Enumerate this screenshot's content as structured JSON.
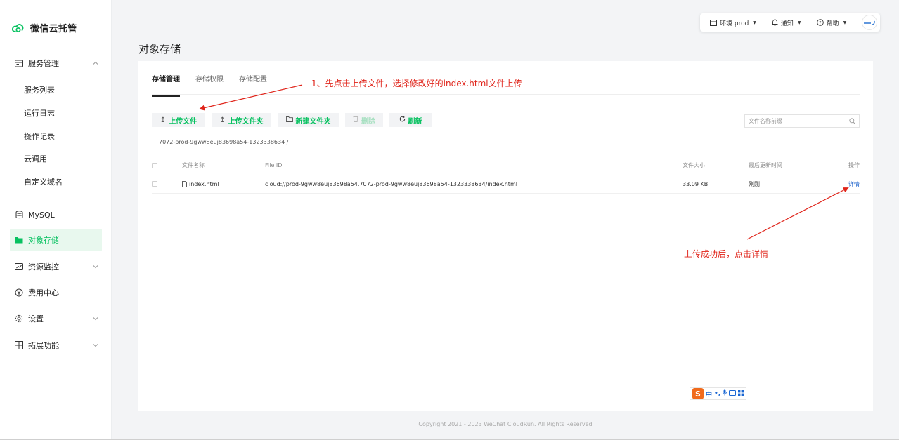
{
  "app": {
    "logo_text": "微信云托管"
  },
  "sidebar": {
    "group_service": "服务管理",
    "sub_items": [
      "服务列表",
      "运行日志",
      "操作记录",
      "云调用",
      "自定义域名"
    ],
    "mysql": "MySQL",
    "object_storage": "对象存储",
    "resource_monitor": "资源监控",
    "billing": "费用中心",
    "settings": "设置",
    "extensions": "拓展功能"
  },
  "topbar": {
    "env_label": "环境 prod",
    "notify_label": "通知",
    "help_label": "帮助"
  },
  "page": {
    "title": "对象存储"
  },
  "tabs": [
    "存储管理",
    "存储权限",
    "存储配置"
  ],
  "toolbar": {
    "upload_file": "上传文件",
    "upload_folder": "上传文件夹",
    "new_folder": "新建文件夹",
    "delete": "删除",
    "refresh": "刷新"
  },
  "search": {
    "placeholder": "文件名称前缀"
  },
  "breadcrumb": "7072-prod-9gww8euj83698a54-1323338634 /",
  "table": {
    "headers": {
      "name": "文件名称",
      "file_id": "File ID",
      "size": "文件大小",
      "updated": "最后更新时间",
      "action": "操作"
    },
    "rows": [
      {
        "name": "index.html",
        "file_id": "cloud://prod-9gww8euj83698a54.7072-prod-9gww8euj83698a54-1323338634/index.html",
        "size": "33.09 KB",
        "updated": "刚刚",
        "action": "详情"
      }
    ]
  },
  "annotations": {
    "step1": "1、先点击上传文件，选择修改好的index.html文件上传",
    "step2": "上传成功后，点击详情"
  },
  "ime": {
    "logo": "S",
    "lang": "中"
  },
  "footer": "Copyright 2021 - 2023 WeChat CloudRun. All Rights Reserved",
  "colors": {
    "brand": "#07c160",
    "annotation": "#e0251b",
    "link": "#2266cc"
  }
}
